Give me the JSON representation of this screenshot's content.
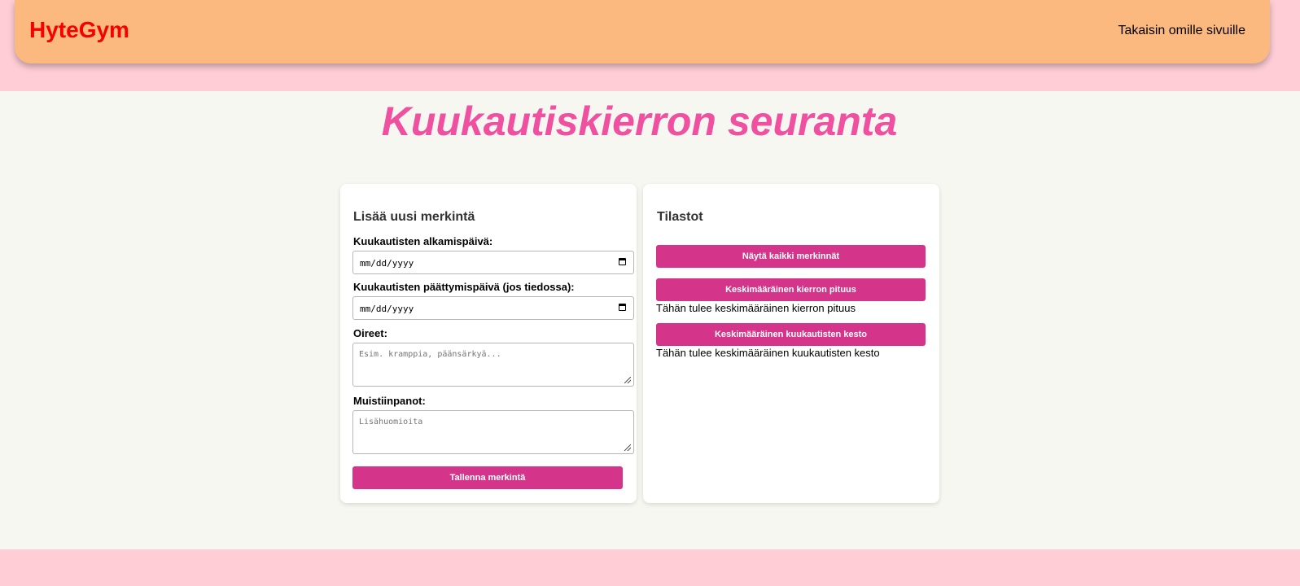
{
  "header": {
    "logo": "HyteGym",
    "back_link": "Takaisin omille sivuille"
  },
  "main": {
    "title": "Kuukautiskierron seuranta"
  },
  "form": {
    "title": "Lisää uusi merkintä",
    "start_label": "Kuukautisten alkamispäivä:",
    "start_value": "mm/dd/yyyy",
    "end_label": "Kuukautisten päättymispäivä (jos tiedossa):",
    "end_value": "mm/dd/yyyy",
    "symptoms_label": "Oireet:",
    "symptoms_placeholder": "Esim. kramppia, päänsärkyä...",
    "notes_label": "Muistiinpanot:",
    "notes_placeholder": "Lisähuomioita",
    "save_button": "Tallenna merkintä"
  },
  "stats": {
    "title": "Tilastot",
    "show_all_button": "Näytä kaikki merkinnät",
    "avg_cycle_button": "Keskimääräinen kierron pituus",
    "avg_cycle_text": "Tähän tulee keskimääräinen kierron pituus",
    "avg_period_button": "Keskimääräinen kuukautisten kesto",
    "avg_period_text": "Tähän tulee keskimääräinen kuukautisten kesto"
  },
  "colors": {
    "header_bg": "#fbb97f",
    "logo": "#f70000",
    "title": "#f050a0",
    "button": "#d4348a",
    "page_bg": "#ffcdd6",
    "content_bg": "#f7f7f2"
  }
}
